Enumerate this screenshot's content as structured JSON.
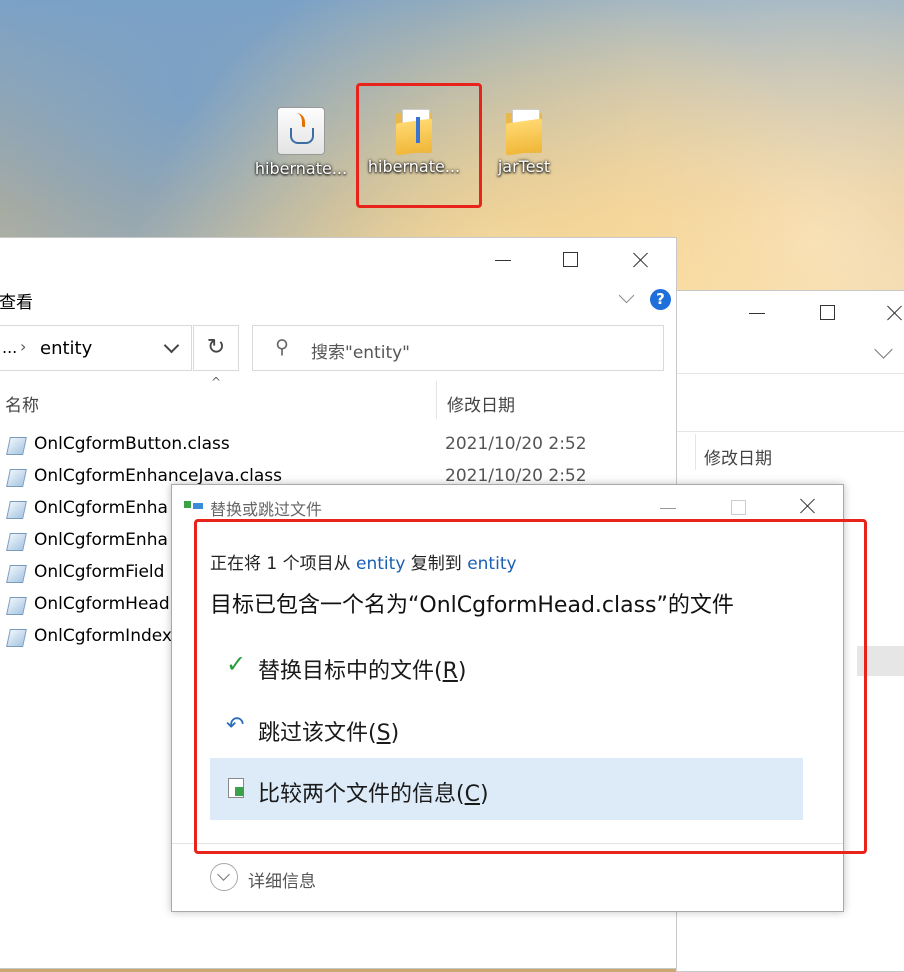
{
  "desktop": {
    "icons": [
      {
        "label": "hibernate...",
        "icon": "java-jar-icon"
      },
      {
        "label": "hibernate...",
        "icon": "folder-icon"
      },
      {
        "label": "jarTest",
        "icon": "folder-icon"
      }
    ]
  },
  "explorer": {
    "ribbon_tab": "查看",
    "breadcrumb_sep": "...",
    "breadcrumb_current": "entity",
    "search_placeholder": "搜索\"entity\"",
    "columns": {
      "name": "名称",
      "modified": "修改日期"
    },
    "files": [
      {
        "name": "OnlCgformButton.class",
        "date": "2021/10/20 2:52"
      },
      {
        "name": "OnlCgformEnhanceJava.class",
        "date": "2021/10/20 2:52"
      },
      {
        "name": "OnlCgformEnha",
        "date": ""
      },
      {
        "name": "OnlCgformEnha",
        "date": ""
      },
      {
        "name": "OnlCgformField",
        "date": ""
      },
      {
        "name": "OnlCgformHead",
        "date": ""
      },
      {
        "name": "OnlCgformIndex",
        "date": ""
      }
    ]
  },
  "explorer2": {
    "column_modified": "修改日期"
  },
  "dialog": {
    "title": "替换或跳过文件",
    "copy_prefix": "正在将 1 个项目从 ",
    "copy_src": "entity",
    "copy_mid": " 复制到 ",
    "copy_dst": "entity",
    "headline": "目标已包含一个名为“OnlCgformHead.class”的文件",
    "options": {
      "replace_main": "替换目标中的文件(",
      "replace_key": "R",
      "skip_main": "跳过该文件(",
      "skip_key": "S",
      "compare_main": "比较两个文件的信息(",
      "compare_key": "C",
      "close_paren": ")"
    },
    "details": "详细信息"
  },
  "colors": {
    "highlight_red": "#e8231b",
    "link_blue": "#1a5fb4",
    "hover_bg": "#dcebf7",
    "check_green": "#2a9d3b"
  }
}
